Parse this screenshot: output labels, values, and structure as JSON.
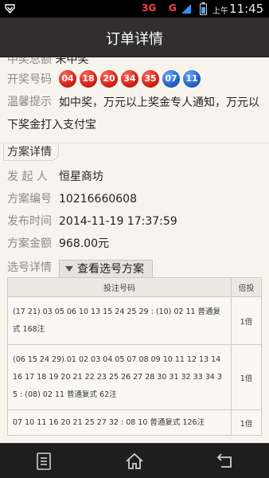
{
  "status_bar": {
    "network": "3G",
    "network2": "G",
    "ampm": "上午",
    "time": "11:45"
  },
  "header": {
    "title": "订单详情"
  },
  "cut_row": {
    "label": "中奖总额",
    "value": "未中奖"
  },
  "draw": {
    "label": "开奖号码",
    "balls": [
      {
        "num": "04",
        "color": "red"
      },
      {
        "num": "18",
        "color": "red"
      },
      {
        "num": "20",
        "color": "red"
      },
      {
        "num": "34",
        "color": "red"
      },
      {
        "num": "35",
        "color": "red"
      },
      {
        "num": "07",
        "color": "blue"
      },
      {
        "num": "11",
        "color": "blue"
      }
    ]
  },
  "tip": {
    "label": "温馨提示",
    "line1": "如中奖，万元以上奖金专人通知，万元以",
    "line2": "下奖金打入支付宝"
  },
  "plan": {
    "section_title": "方案详情",
    "fields": [
      {
        "label": "发 起 人",
        "value": "恒星商坊"
      },
      {
        "label": "方案编号",
        "value": "10216660608"
      },
      {
        "label": "发布时间",
        "value": "2014-11-19 17:37:59"
      },
      {
        "label": "方案金额",
        "value": "968.00元"
      }
    ],
    "select_label": "选号详情",
    "view_button": "查看选号方案"
  },
  "table": {
    "headers": {
      "code": "投注号码",
      "multiple": "倍投"
    },
    "rows": [
      {
        "code": "(17 21) 03 05 06 10 13 15 24 25 29 : (10) 02 11 普通复式 168注",
        "multiple": "1倍"
      },
      {
        "code": "(06 15 24 29) 01 02 03 04 05 07 08 09 10 11 12 13 14 16 17 18 19 20 21 22 23 25 26 27 28 30 31 32 33 34 35 : (08) 02 11 普通复式 62注",
        "multiple": "1倍"
      },
      {
        "code": "07 10 11 16 20 21 25 27 32 : 08 10 普通复式 126注",
        "multiple": "1倍"
      }
    ]
  },
  "colors": {
    "red_ball": "#d8251a",
    "blue_ball": "#2867cf",
    "title_bar": "#302e2e",
    "background": "#f7f4ee"
  }
}
